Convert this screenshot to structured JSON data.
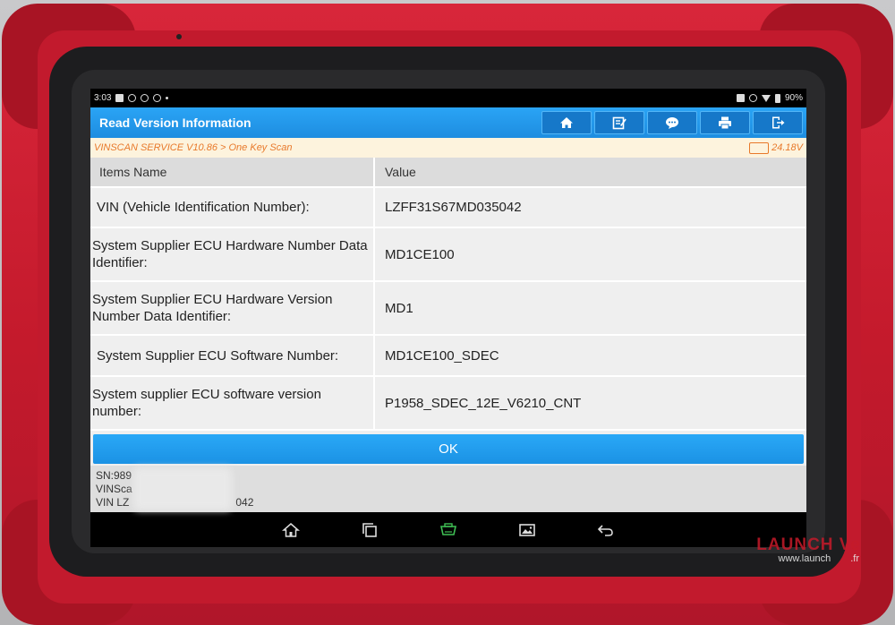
{
  "status_bar": {
    "time": "3:03",
    "battery": "90%"
  },
  "header": {
    "title": "Read Version Information",
    "buttons": [
      {
        "icon": "home-icon"
      },
      {
        "icon": "edit-icon"
      },
      {
        "icon": "feedback-icon"
      },
      {
        "icon": "print-icon"
      },
      {
        "icon": "exit-icon"
      }
    ]
  },
  "breadcrumb": {
    "path": "VINSCAN SERVICE V10.86 > One Key Scan",
    "voltage": "24.18V"
  },
  "table": {
    "headers": {
      "name": "Items Name",
      "value": "Value"
    },
    "rows": [
      {
        "name": " VIN (Vehicle Identification Number):",
        "value": "LZFF31S67MD035042"
      },
      {
        "name": " System Supplier ECU Hardware Number Data Identifier:",
        "value": "MD1CE100"
      },
      {
        "name": " System Supplier ECU Hardware Version Number Data Identifier:",
        "value": "MD1"
      },
      {
        "name": " System Supplier ECU Software Number:",
        "value": "MD1CE100_SDEC"
      },
      {
        "name": " System supplier ECU software version number:",
        "value": "P1958_SDEC_12E_V6210_CNT"
      }
    ]
  },
  "ok_button": {
    "label": "OK"
  },
  "info_panel": {
    "line1": "SN:989",
    "line2": "VINSca",
    "line3_prefix": "VIN LZ",
    "line3_suffix": "042"
  },
  "nav": [
    {
      "icon": "home-icon"
    },
    {
      "icon": "recent-apps-icon"
    },
    {
      "icon": "vci-icon"
    },
    {
      "icon": "screenshot-icon"
    },
    {
      "icon": "back-icon"
    }
  ],
  "watermark": {
    "brand": "LAUNCH",
    "suffix": "Ve",
    "url": "www.launch",
    "url_suffix": ".fr"
  },
  "colors": {
    "accent": "#1e8de0",
    "crumb_text": "#e8792b",
    "crumb_bg": "#fdf3dd",
    "bumper": "#c41a2c"
  }
}
